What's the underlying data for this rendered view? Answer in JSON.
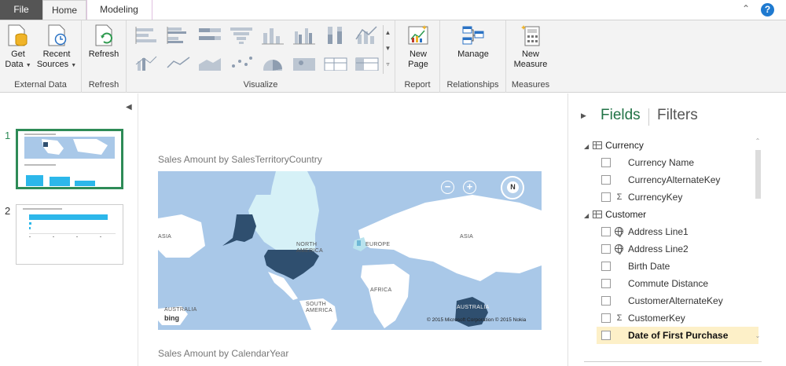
{
  "tabs": {
    "file": "File",
    "home": "Home",
    "modeling": "Modeling"
  },
  "window": {
    "help": "?"
  },
  "ribbon": {
    "external_data": {
      "label": "External Data",
      "get_data": {
        "line1": "Get",
        "line2": "Data"
      },
      "recent_sources": {
        "line1": "Recent",
        "line2": "Sources"
      }
    },
    "refresh": {
      "label": "Refresh",
      "button": "Refresh"
    },
    "visualize": {
      "label": "Visualize"
    },
    "report": {
      "label": "Report",
      "new_page": {
        "line1": "New",
        "line2": "Page"
      }
    },
    "relationships": {
      "label": "Relationships",
      "manage": "Manage"
    },
    "measures": {
      "label": "Measures",
      "new_measure": {
        "line1": "New",
        "line2": "Measure"
      }
    }
  },
  "pages": [
    {
      "number": "1",
      "active": true
    },
    {
      "number": "2",
      "active": false
    }
  ],
  "canvas": {
    "visual1_title": "Sales Amount by SalesTerritoryCountry",
    "visual2_title": "Sales Amount by CalendarYear",
    "map": {
      "labels": {
        "asia_left": "ASIA",
        "north_america": "NORTH AMERICA",
        "europe": "EUROPE",
        "asia_right": "ASIA",
        "africa": "AFRICA",
        "south_america": "SOUTH AMERICA",
        "australia_left": "AUSTRALIA",
        "australia_right": "AUSTRALIA"
      },
      "zoom_out": "−",
      "zoom_in": "+",
      "compass": "N",
      "bing": "bing",
      "copyright": "© 2015 Microsoft Corporation   © 2015 Nokia"
    }
  },
  "fields_pane": {
    "tab_fields": "Fields",
    "tab_filters": "Filters",
    "tables": [
      {
        "name": "Currency",
        "fields": [
          {
            "label": "Currency Name",
            "icon": ""
          },
          {
            "label": "CurrencyAlternateKey",
            "icon": ""
          },
          {
            "label": "CurrencyKey",
            "icon": "sigma"
          }
        ]
      },
      {
        "name": "Customer",
        "fields": [
          {
            "label": "Address Line1",
            "icon": "globe"
          },
          {
            "label": "Address Line2",
            "icon": "globe"
          },
          {
            "label": "Birth Date",
            "icon": ""
          },
          {
            "label": "Commute Distance",
            "icon": ""
          },
          {
            "label": "CustomerAlternateKey",
            "icon": ""
          },
          {
            "label": "CustomerKey",
            "icon": "sigma"
          },
          {
            "label": "Date of First Purchase",
            "icon": ""
          }
        ]
      }
    ],
    "sigma_glyph": "Σ"
  },
  "colors": {
    "accent_green": "#217346",
    "page_active_border": "#2e8b57",
    "map_water": "#a9c8e8",
    "map_land": "#ffffff",
    "map_highlight_dark": "#2f4f6f",
    "map_highlight_light": "#d6f1f7",
    "bar_blue": "#2cb7ea",
    "field_highlight": "#fdf0c8"
  }
}
